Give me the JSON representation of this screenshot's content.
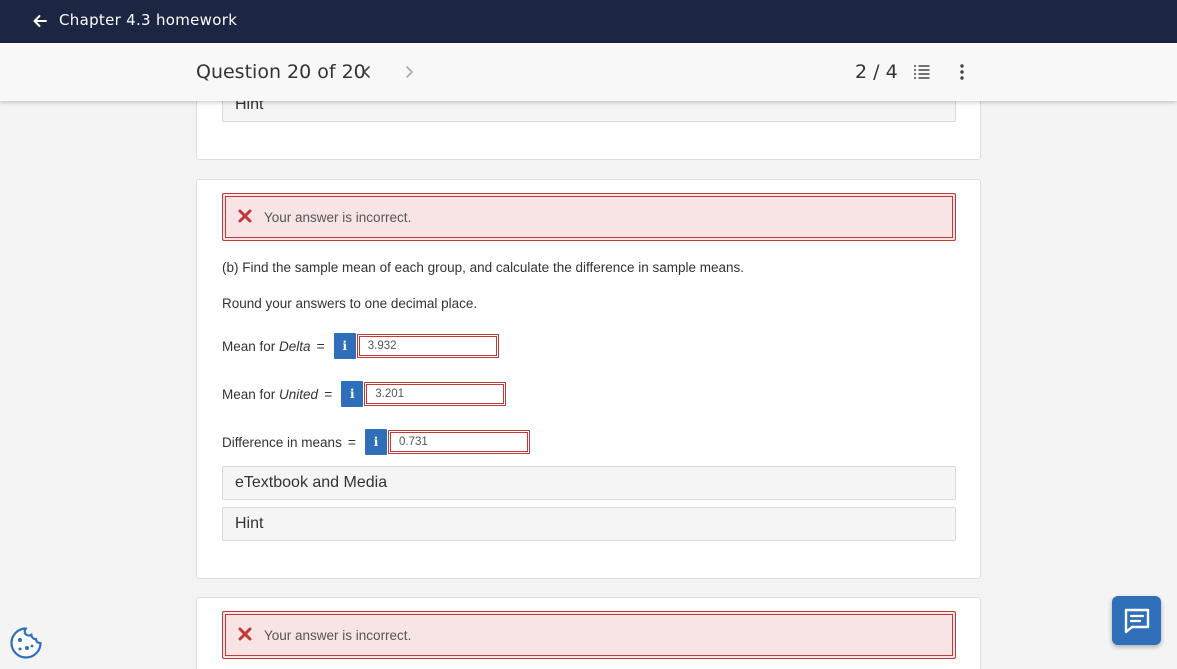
{
  "header": {
    "course_title": "Chapter 4.3 homework",
    "back_icon": "arrow-left-icon"
  },
  "question_bar": {
    "counter": "Question 20 of 20",
    "prev_icon": "chevron-left-icon",
    "next_icon": "chevron-right-icon",
    "page_count": "2 / 4",
    "list_icon": "list-icon",
    "more_icon": "more-vertical-icon"
  },
  "card_1": {
    "hint_label": "Hint"
  },
  "card_2": {
    "alert_text": "Your answer is incorrect.",
    "prompt": "(b) Find the sample mean of each group, and calculate the difference in sample means.",
    "instruction": "Round your answers to one decimal place.",
    "fields": [
      {
        "label_prefix": "Mean for ",
        "label_italic": "Delta",
        "equals": "=",
        "info": "i",
        "value": "3.932"
      },
      {
        "label_prefix": "Mean for ",
        "label_italic": "United",
        "equals": "=",
        "info": "i",
        "value": "3.201"
      },
      {
        "label_prefix": "Difference in means",
        "label_italic": "",
        "equals": "=",
        "info": "i",
        "value": "0.731"
      }
    ],
    "etextbook_label": "eTextbook and Media",
    "hint_label": "Hint"
  },
  "card_3": {
    "alert_text": "Your answer is incorrect."
  },
  "colors": {
    "topbar": "#1c2541",
    "error": "#c03a3a",
    "error_bg": "#f8e4e4",
    "accent": "#2f6fb9"
  },
  "floating": {
    "chat_icon": "chat-icon",
    "cookie_icon": "cookie-icon"
  }
}
